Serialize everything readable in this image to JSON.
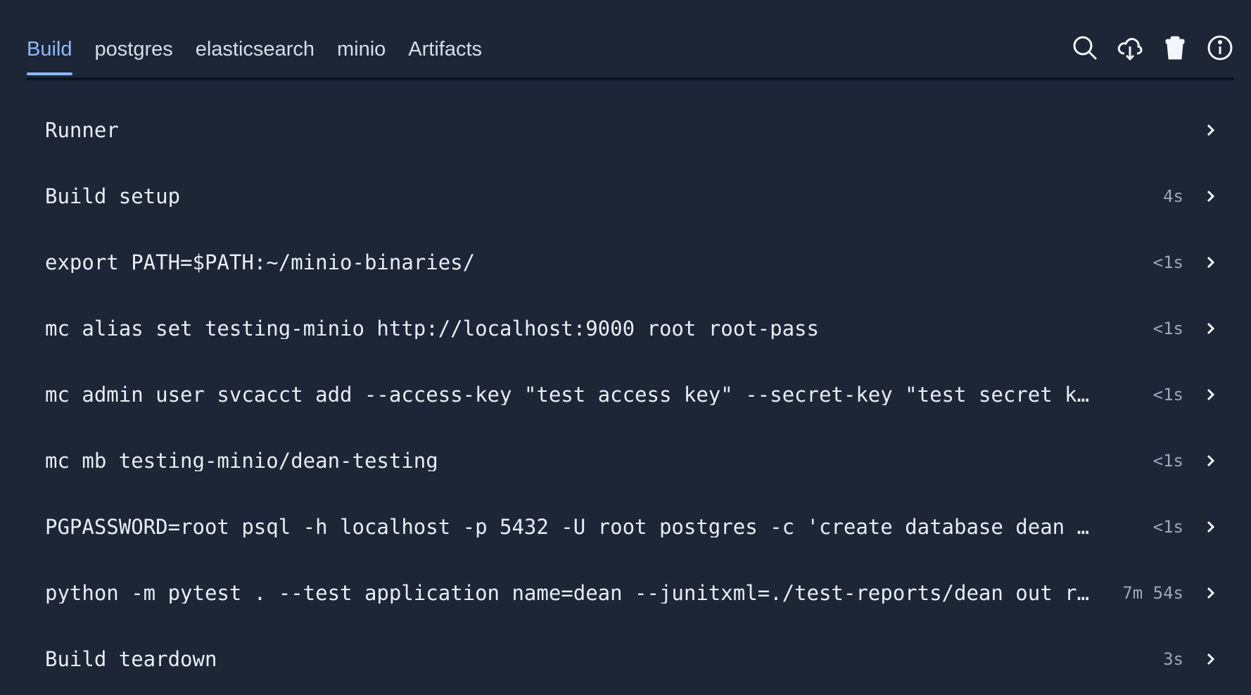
{
  "tabs": [
    {
      "label": "Build",
      "active": true
    },
    {
      "label": "postgres",
      "active": false
    },
    {
      "label": "elasticsearch",
      "active": false
    },
    {
      "label": "minio",
      "active": false
    },
    {
      "label": "Artifacts",
      "active": false
    }
  ],
  "toolbar_icons": [
    "search-icon",
    "cloud-download-icon",
    "trash-icon",
    "info-icon"
  ],
  "steps": [
    {
      "label": "Runner",
      "duration": ""
    },
    {
      "label": "Build setup",
      "duration": "4s"
    },
    {
      "label": "export PATH=$PATH:~/minio-binaries/",
      "duration": "<1s"
    },
    {
      "label": "mc alias set testing-minio http://localhost:9000 root root-pass",
      "duration": "<1s"
    },
    {
      "label": "mc admin user svcacct add --access-key \"test_access_key\" --secret-key \"test_secret_key\" …",
      "duration": "<1s"
    },
    {
      "label": "mc mb testing-minio/dean-testing",
      "duration": "<1s"
    },
    {
      "label": "PGPASSWORD=root psql -h localhost -p 5432 -U root postgres -c 'create database dean_unit…",
      "duration": "<1s"
    },
    {
      "label": "python -m pytest . --test_application_name=dean --junitxml=./test-reports/dean_out_repor…",
      "duration": "7m 54s"
    },
    {
      "label": "Build teardown",
      "duration": "3s"
    }
  ],
  "colors": {
    "background": "#1c2637",
    "active_tab": "#8fb8ff",
    "text": "#e8edf4",
    "muted": "#9ca7b7"
  }
}
